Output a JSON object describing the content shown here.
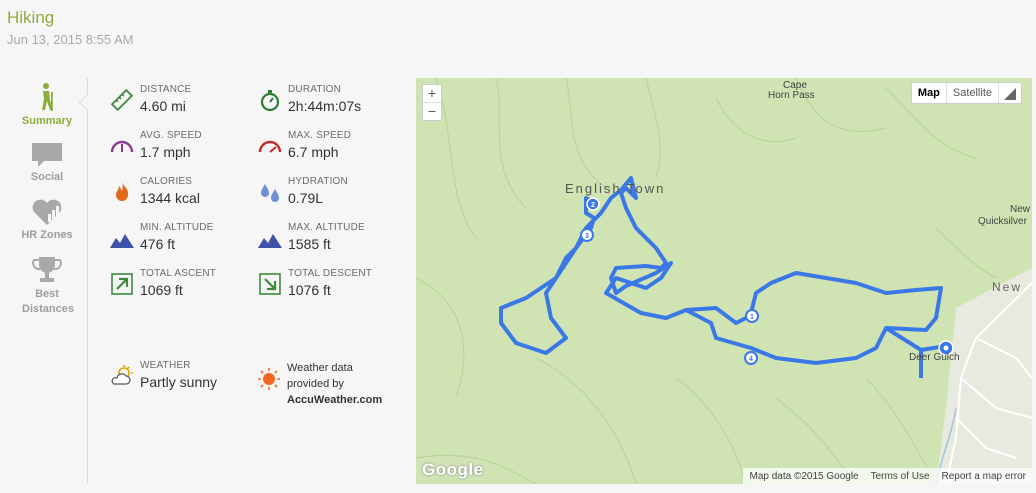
{
  "header": {
    "title": "Hiking",
    "date": "Jun 13, 2015 8:55 AM"
  },
  "tabs": [
    {
      "label": "Summary",
      "icon": "hiker-icon"
    },
    {
      "label": "Social",
      "icon": "speech-bubble-icon"
    },
    {
      "label": "HR Zones",
      "icon": "heart-chart-icon"
    },
    {
      "label": "Best Distances",
      "icon": "trophy-icon"
    }
  ],
  "stats": [
    {
      "label": "DISTANCE",
      "value": "4.60 mi",
      "icon": "ruler-icon"
    },
    {
      "label": "DURATION",
      "value": "2h:44m:07s",
      "icon": "stopwatch-icon"
    },
    {
      "label": "AVG. SPEED",
      "value": "1.7 mph",
      "icon": "speedometer-avg-icon"
    },
    {
      "label": "MAX. SPEED",
      "value": "6.7 mph",
      "icon": "speedometer-max-icon"
    },
    {
      "label": "CALORIES",
      "value": "1344 kcal",
      "icon": "flame-icon"
    },
    {
      "label": "HYDRATION",
      "value": "0.79L",
      "icon": "water-drops-icon"
    },
    {
      "label": "MIN. ALTITUDE",
      "value": "476 ft",
      "icon": "mountain-min-icon"
    },
    {
      "label": "MAX. ALTITUDE",
      "value": "1585 ft",
      "icon": "mountain-max-icon"
    },
    {
      "label": "TOTAL ASCENT",
      "value": "1069 ft",
      "icon": "arrow-up-right-icon"
    },
    {
      "label": "TOTAL DESCENT",
      "value": "1076 ft",
      "icon": "arrow-down-right-icon"
    }
  ],
  "weather": {
    "label": "WEATHER",
    "value": "Partly sunny",
    "icon": "partly-sunny-icon"
  },
  "weather_credit": {
    "line1": "Weather data",
    "line2": "provided by",
    "brand": "AccuWeather.com",
    "icon": "accuweather-sun-icon"
  },
  "map": {
    "zoom_in": "+",
    "zoom_out": "−",
    "type_map": "Map",
    "type_satellite": "Satellite",
    "logo": "Google",
    "attribution": [
      "Map data ©2015 Google",
      "Terms of Use",
      "Report a map error"
    ],
    "places": [
      "Cape",
      "Horn Pass",
      "English Town",
      "New",
      "Quicksilver",
      "New",
      "Deer Gulch"
    ],
    "lap_markers": [
      "1",
      "2",
      "3",
      "4"
    ],
    "colors": {
      "route": "#3b78e7",
      "terrain": "#cfe3b3",
      "accent": "#8cad3c"
    }
  }
}
